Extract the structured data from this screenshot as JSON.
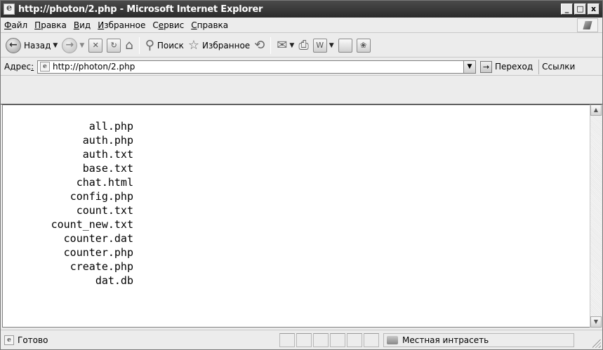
{
  "window": {
    "title": "http://photon/2.php - Microsoft Internet Explorer"
  },
  "title_buttons": {
    "minimize": "_",
    "maximize": "□",
    "close": "x"
  },
  "menu": {
    "items": [
      {
        "acc": "Ф",
        "rest": "айл"
      },
      {
        "acc": "П",
        "rest": "равка"
      },
      {
        "acc": "В",
        "rest": "ид"
      },
      {
        "acc": "И",
        "rest": "збранное"
      },
      {
        "pre": "С",
        "acc": "е",
        "rest": "рвис"
      },
      {
        "acc": "С",
        "rest": "правка"
      }
    ]
  },
  "toolbar": {
    "back_label": "Назад",
    "search_label": "Поиск",
    "favorites_label": "Избранное"
  },
  "address": {
    "label_pre": "Адрес",
    "label_acc": ":",
    "value": "http://photon/2.php",
    "go_label": "Переход",
    "links_label": "Ссылки"
  },
  "content": {
    "files": [
      "all.php",
      "auth.php",
      "auth.txt",
      "base.txt",
      "chat.html",
      "config.php",
      "count.txt",
      "count_new.txt",
      "counter.dat",
      "counter.php",
      "create.php",
      "dat.db"
    ]
  },
  "status": {
    "text": "Готово",
    "zone": "Местная интрасеть"
  }
}
